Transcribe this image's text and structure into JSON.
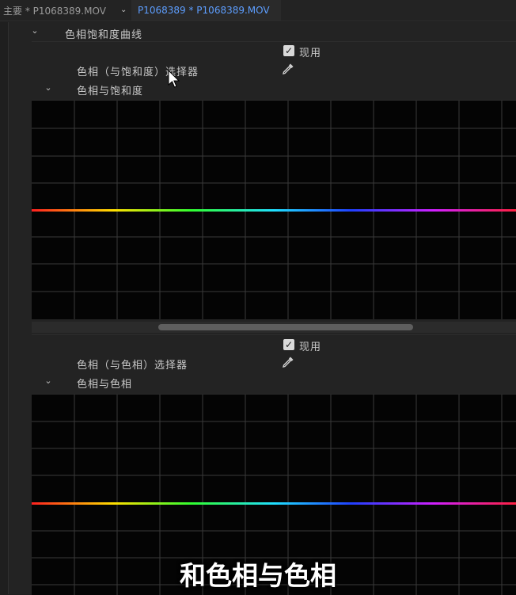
{
  "tabs": {
    "main_label": "主要 * P1068389.MOV",
    "active_label": "P1068389 * P1068389.MOV"
  },
  "section": {
    "title": "色相饱和度曲线"
  },
  "curve1": {
    "enable_label": "现用",
    "selector_label": "色相（与饱和度）选择器",
    "graph_title": "色相与饱和度"
  },
  "curve2": {
    "enable_label": "现用",
    "selector_label": "色相（与色相）选择器",
    "graph_title": "色相与色相"
  },
  "subtitle": "和色相与色相",
  "icons": {
    "expand": "chevron-down-icon",
    "checkbox": "check-icon",
    "eyedropper": "eyedropper-icon",
    "cursor": "mouse-cursor-icon"
  },
  "colors": {
    "accent": "#5d9eff",
    "background": "#1f1f1f",
    "graph_background": "#040404"
  }
}
